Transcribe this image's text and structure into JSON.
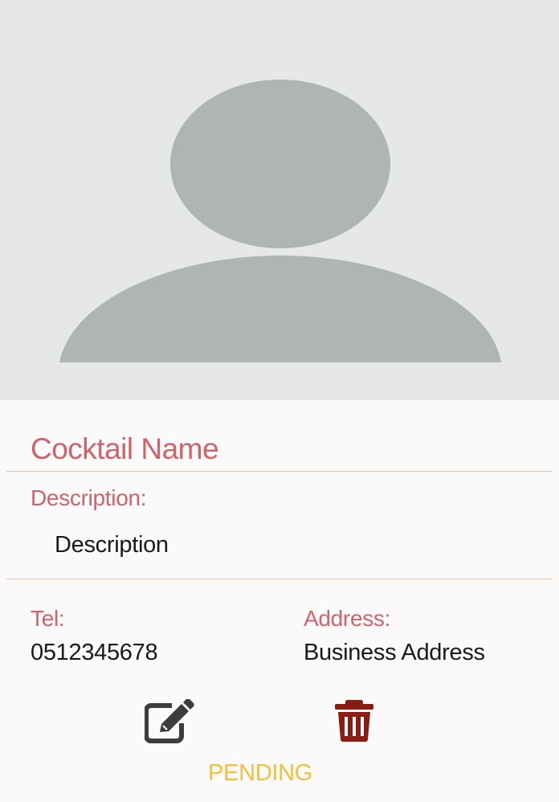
{
  "card": {
    "photo_icon": "user-avatar-placeholder-icon",
    "name": "Cocktail Name",
    "description_label": "Description:",
    "description_value": "Description",
    "tel_label": "Tel:",
    "tel_value": "0512345678",
    "address_label": "Address:",
    "address_value": "Business Address",
    "status": "PENDING"
  },
  "actions": {
    "edit_icon": "edit-icon",
    "delete_icon": "trash-icon"
  },
  "colors": {
    "accent_label": "#d0626a",
    "divider": "#f2c29d",
    "status_pending": "#f4c03a",
    "delete": "#8b1c14",
    "edit": "#3d3d3b",
    "avatar": "#afb4b5",
    "photo_bg": "#e6e7e8"
  }
}
